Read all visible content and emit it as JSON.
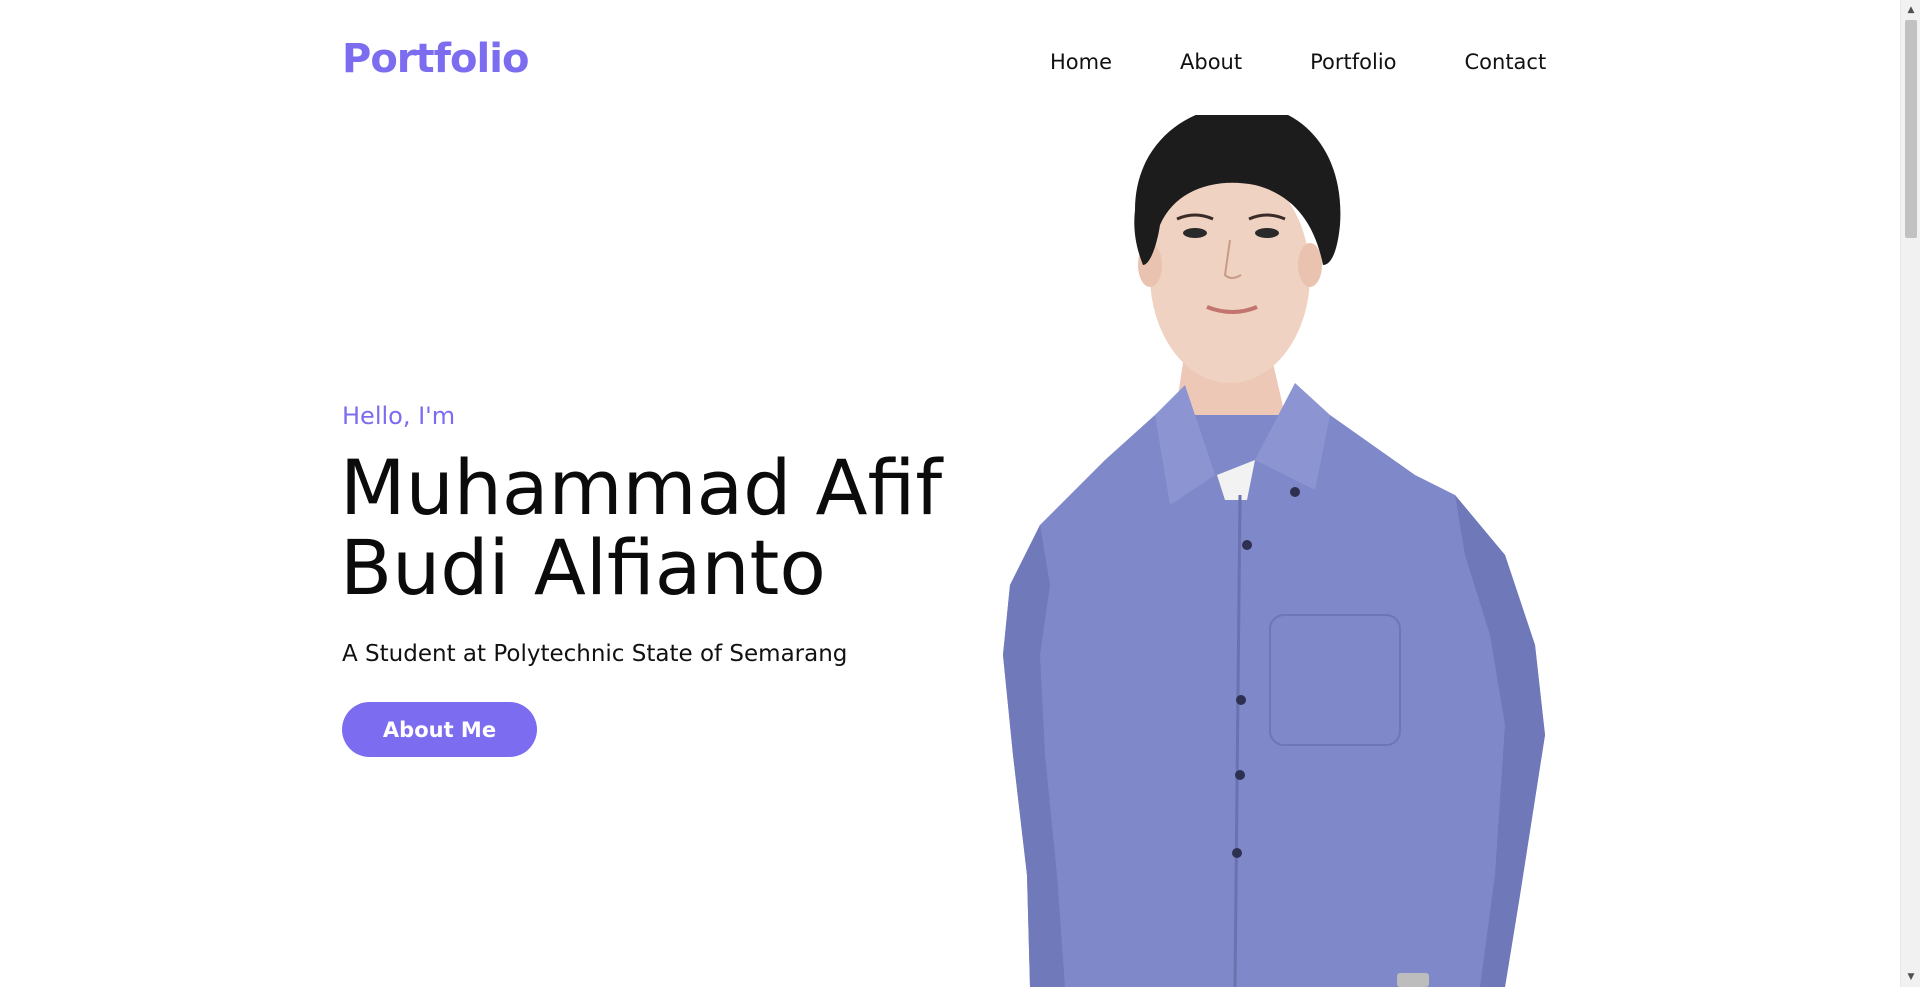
{
  "header": {
    "logo": "Portfolio",
    "nav": [
      {
        "label": "Home"
      },
      {
        "label": "About"
      },
      {
        "label": "Portfolio"
      },
      {
        "label": "Contact"
      }
    ]
  },
  "hero": {
    "greeting": "Hello, I'm",
    "name_line1": "Muhammad Afif",
    "name_line2": "Budi Alfianto",
    "tagline": "A Student at Polytechnic State of Semarang",
    "cta_label": "About Me"
  },
  "colors": {
    "accent": "#7b6cf0",
    "text": "#0b0b0b",
    "shirt": "#7f88c8",
    "hair": "#1c1c1c",
    "skin": "#f0d2c2"
  },
  "scrollbar": {
    "up_icon": "triangle-up-icon",
    "down_icon": "triangle-down-icon"
  }
}
